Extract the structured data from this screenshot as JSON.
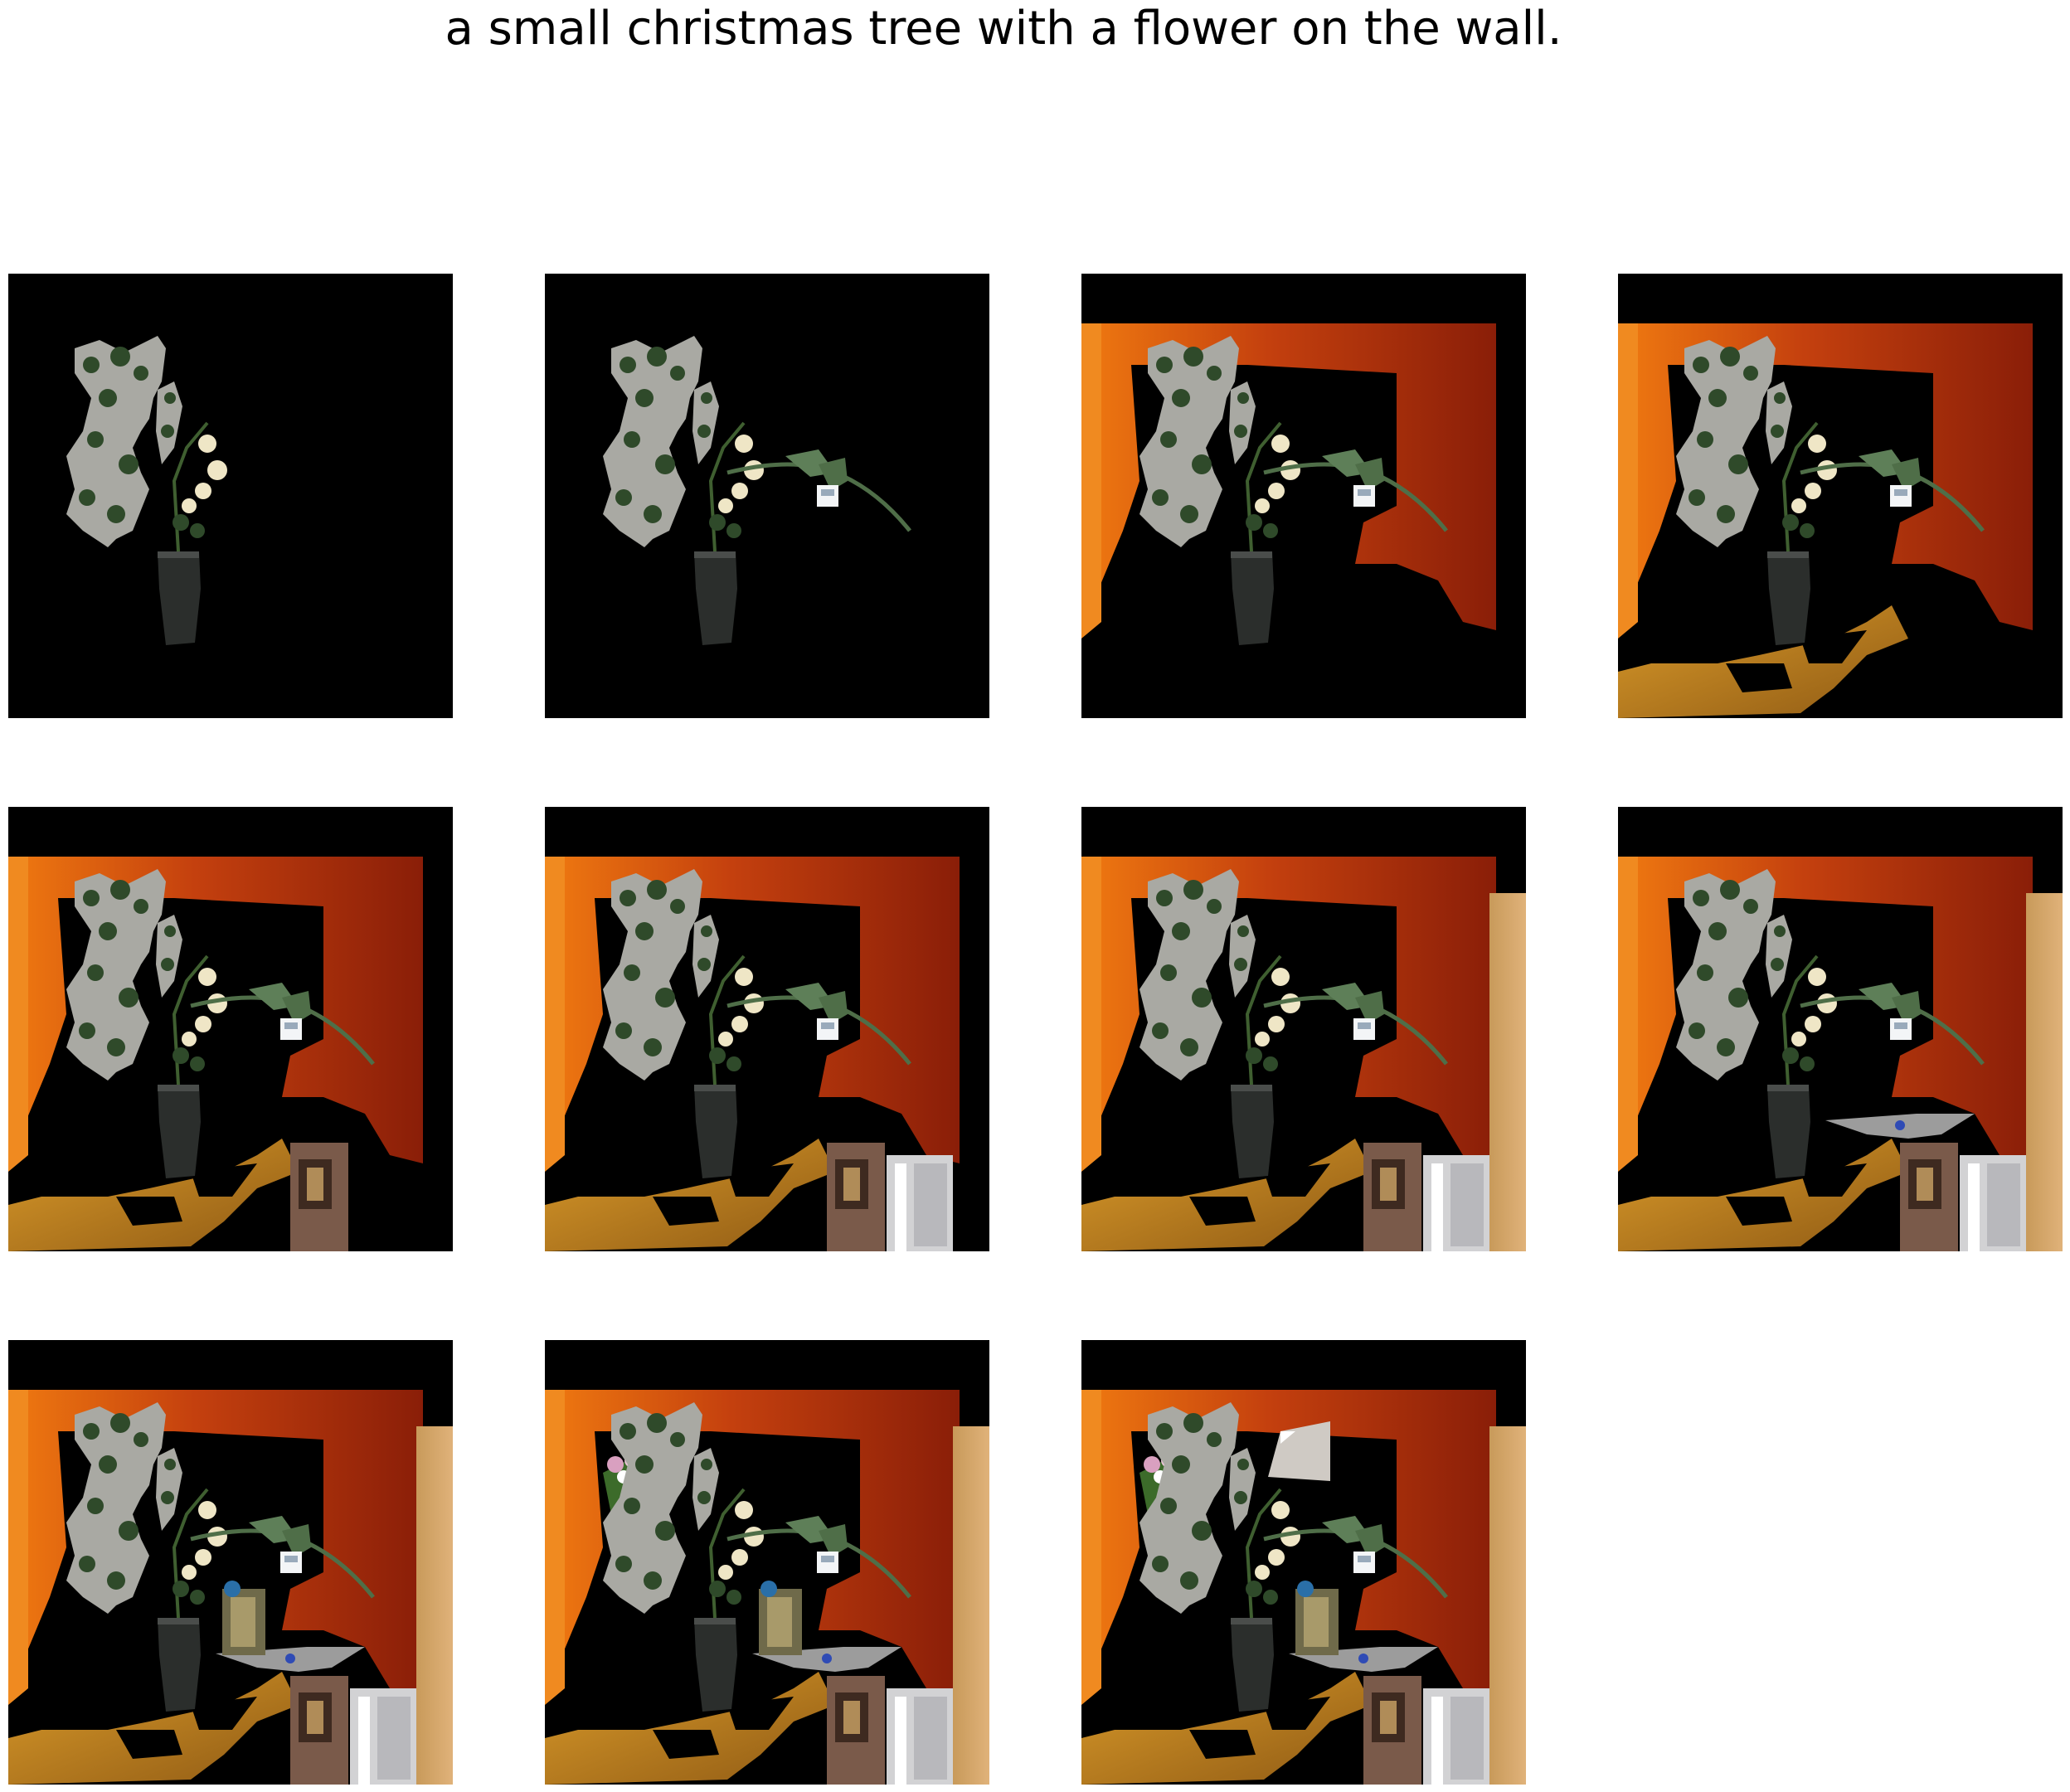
{
  "caption": "a small christmas tree with a flower on the wall.",
  "steps": [
    {
      "layers": [
        "tree",
        "vase",
        "roses"
      ]
    },
    {
      "layers": [
        "tree",
        "vase",
        "roses",
        "branch"
      ]
    },
    {
      "layers": [
        "tree",
        "vase",
        "roses",
        "branch",
        "wall"
      ]
    },
    {
      "layers": [
        "tree",
        "vase",
        "roses",
        "branch",
        "wall",
        "table"
      ]
    },
    {
      "layers": [
        "tree",
        "vase",
        "roses",
        "branch",
        "wall",
        "table",
        "book"
      ]
    },
    {
      "layers": [
        "tree",
        "vase",
        "roses",
        "branch",
        "wall",
        "table",
        "book",
        "box"
      ]
    },
    {
      "layers": [
        "tree",
        "vase",
        "roses",
        "branch",
        "wall",
        "table",
        "book",
        "box",
        "cabinet"
      ]
    },
    {
      "layers": [
        "tree",
        "vase",
        "roses",
        "branch",
        "wall",
        "table",
        "book",
        "box",
        "cabinet",
        "tray"
      ]
    },
    {
      "layers": [
        "tree",
        "vase",
        "roses",
        "branch",
        "wall",
        "table",
        "book",
        "box",
        "cabinet",
        "tray",
        "trinket"
      ]
    },
    {
      "layers": [
        "tree",
        "vase",
        "roses",
        "branch",
        "wall",
        "table",
        "book",
        "box",
        "cabinet",
        "tray",
        "trinket",
        "flower"
      ]
    },
    {
      "layers": [
        "tree",
        "vase",
        "roses",
        "branch",
        "wall",
        "table",
        "book",
        "box",
        "cabinet",
        "tray",
        "trinket",
        "flower",
        "card"
      ]
    }
  ],
  "colors": {
    "background": "#ffffff",
    "panel": "#000000",
    "wall_light": "#f07a10",
    "wall_dark": "#8a1e08",
    "table": "#c8861c",
    "tree_gray": "#a9a9a3",
    "leaf": "#2f4a2a",
    "vase": "#2b2e2c",
    "rose": "#efe6c6",
    "cabinet": "#d2d2d4",
    "book": "#7a5a4a",
    "flower": "#d9a0c0"
  }
}
